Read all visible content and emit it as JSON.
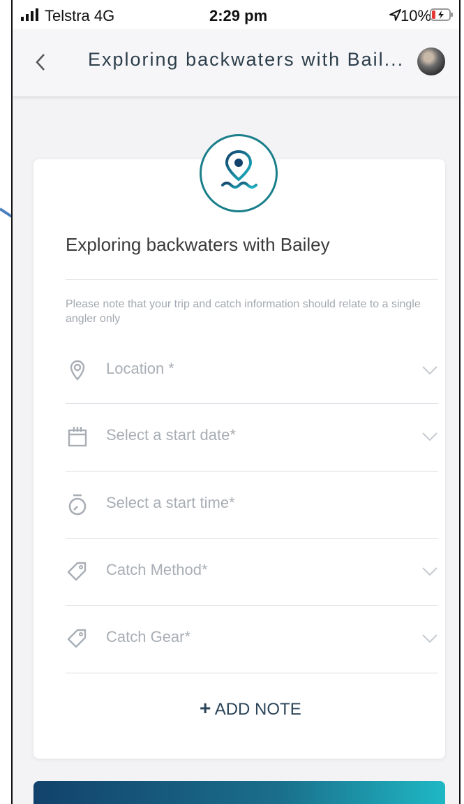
{
  "status_bar": {
    "carrier": "Telstra  4G",
    "time": "2:29 pm",
    "battery": "10%"
  },
  "header": {
    "title": "Exploring backwaters with Bail..."
  },
  "trip": {
    "name": "Exploring backwaters with Bailey",
    "note": "Please note that your trip and catch information should relate to a single angler only"
  },
  "fields": [
    {
      "label": "Location *",
      "icon": "map-pin-icon",
      "dropdown": true
    },
    {
      "label": "Select a start date*",
      "icon": "calendar-icon",
      "dropdown": true
    },
    {
      "label": "Select a start time*",
      "icon": "stopwatch-icon",
      "dropdown": false
    },
    {
      "label": "Catch Method*",
      "icon": "tag-icon",
      "dropdown": true
    },
    {
      "label": "Catch Gear*",
      "icon": "tag-icon",
      "dropdown": true
    }
  ],
  "add_note": {
    "plus": "+",
    "label": "ADD NOTE"
  },
  "colors": {
    "accent": "#1a7f8a",
    "navy": "#2c4559",
    "muted": "#a8aeb5",
    "gradient_start": "#12426b",
    "gradient_end": "#1fb8c4"
  }
}
